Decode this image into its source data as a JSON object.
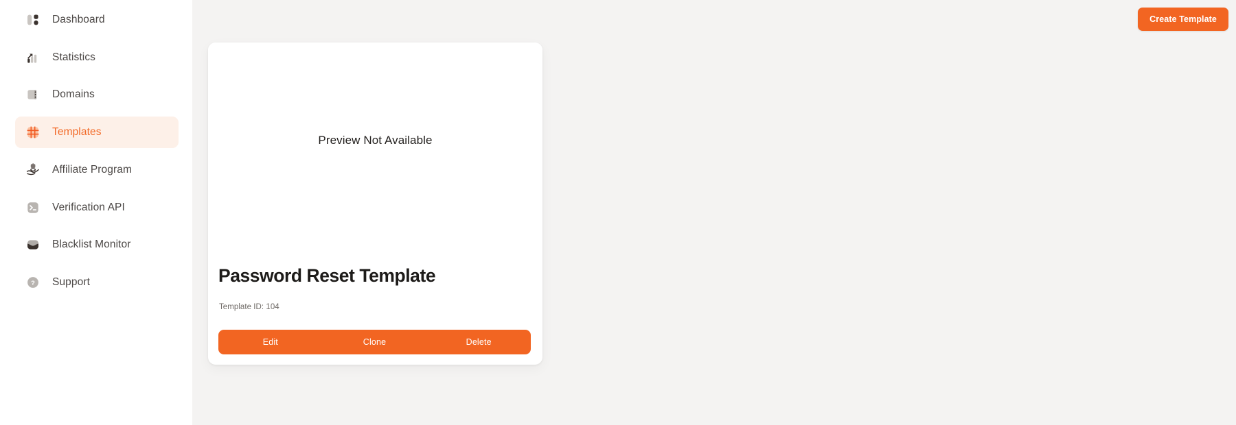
{
  "sidebar": {
    "items": [
      {
        "label": "Dashboard",
        "icon": "dashboard-icon",
        "active": false
      },
      {
        "label": "Statistics",
        "icon": "statistics-icon",
        "active": false
      },
      {
        "label": "Domains",
        "icon": "domains-icon",
        "active": false
      },
      {
        "label": "Templates",
        "icon": "templates-grid-icon",
        "active": true
      },
      {
        "label": "Affiliate Program",
        "icon": "affiliate-hand-icon",
        "active": false
      },
      {
        "label": "Verification API",
        "icon": "terminal-icon",
        "active": false
      },
      {
        "label": "Blacklist Monitor",
        "icon": "blacklist-shield-icon",
        "active": false
      },
      {
        "label": "Support",
        "icon": "question-mark-icon",
        "active": false
      }
    ]
  },
  "toolbar": {
    "create_template_label": "Create Template"
  },
  "card": {
    "preview_placeholder": "Preview Not Available",
    "title": "Password Reset Template",
    "template_id_label": "Template ID: 104",
    "actions": [
      {
        "label": "Edit"
      },
      {
        "label": "Clone"
      },
      {
        "label": "Delete"
      }
    ]
  },
  "colors": {
    "accent": "#F26522",
    "accent_soft": "#FDF0E8",
    "page_background": "#F4F3F2",
    "sidebar_background": "#FFFFFF",
    "text_primary": "#1D1B19",
    "text_muted": "#6F6A66"
  }
}
